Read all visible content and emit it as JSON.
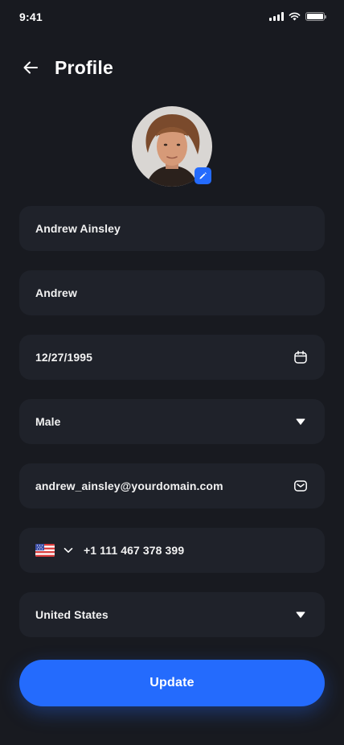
{
  "status_bar": {
    "time": "9:41"
  },
  "header": {
    "title": "Profile"
  },
  "form": {
    "full_name": "Andrew Ainsley",
    "nickname": "Andrew",
    "date_of_birth": "12/27/1995",
    "gender": "Male",
    "email": "andrew_ainsley@yourdomain.com",
    "phone": "+1 111 467 378 399",
    "country": "United States"
  },
  "icons": {
    "back": "arrow-left-icon",
    "edit": "pencil-icon",
    "calendar": "calendar-icon",
    "dropdown": "caret-down-icon",
    "email": "envelope-icon",
    "flag": "us-flag-icon",
    "chevron": "chevron-down-icon"
  },
  "colors": {
    "background": "#181a20",
    "field_background": "#1f222a",
    "accent": "#246bfd",
    "text": "#ffffff"
  },
  "actions": {
    "update_label": "Update"
  }
}
